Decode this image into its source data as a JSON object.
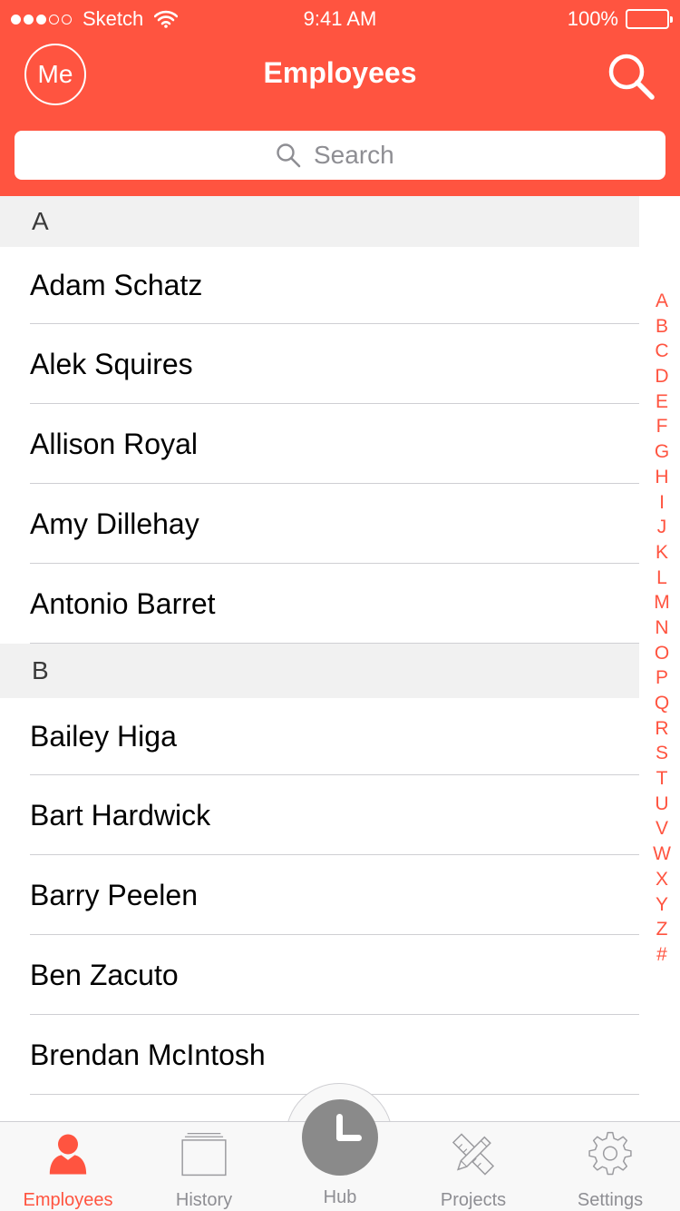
{
  "status_bar": {
    "carrier": "Sketch",
    "time": "9:41 AM",
    "battery": "100%"
  },
  "header": {
    "me_label": "Me",
    "title": "Employees"
  },
  "search": {
    "placeholder": "Search"
  },
  "sections": [
    {
      "letter": "A",
      "names": [
        "Adam Schatz",
        "Alek Squires",
        "Allison Royal",
        "Amy Dillehay",
        "Antonio Barret"
      ]
    },
    {
      "letter": "B",
      "names": [
        "Bailey Higa",
        "Bart Hardwick",
        "Barry Peelen",
        "Ben Zacuto",
        "Brendan McIntosh"
      ]
    }
  ],
  "index_letters": [
    "A",
    "B",
    "C",
    "D",
    "E",
    "F",
    "G",
    "H",
    "I",
    "J",
    "K",
    "L",
    "M",
    "N",
    "O",
    "P",
    "Q",
    "R",
    "S",
    "T",
    "U",
    "V",
    "W",
    "X",
    "Y",
    "Z",
    "#"
  ],
  "tabs": [
    {
      "label": "Employees",
      "icon": "person-icon",
      "active": true
    },
    {
      "label": "History",
      "icon": "history-icon",
      "active": false
    },
    {
      "label": "Hub",
      "icon": "clock-icon",
      "active": false
    },
    {
      "label": "Projects",
      "icon": "pencil-ruler-icon",
      "active": false
    },
    {
      "label": "Settings",
      "icon": "gear-icon",
      "active": false
    }
  ],
  "colors": {
    "accent": "#ff5440",
    "inactive": "#8e8e93",
    "hub": "#8a8a8a"
  }
}
